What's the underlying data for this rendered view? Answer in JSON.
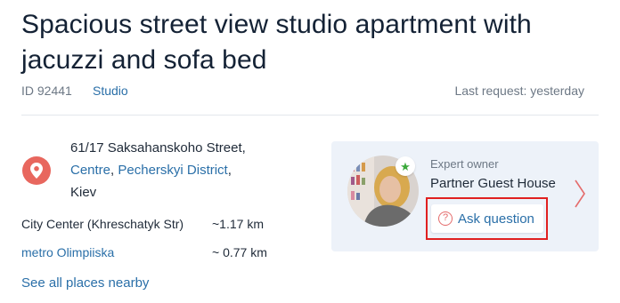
{
  "listing": {
    "title": "Spacious street view studio apartment with jacuzzi and sofa bed",
    "id_text": "ID 92441",
    "type": "Studio",
    "last_request": "Last request: yesterday"
  },
  "address": {
    "street": "61/17 Saksahanskoho Street,",
    "area_link": "Centre",
    "separator": ", ",
    "district_link": "Pecherskyi District",
    "district_suffix": ",",
    "city": "Kiev"
  },
  "distances": [
    {
      "label": "City Center (Khreschatyk Str)",
      "value": "~1.17 km"
    },
    {
      "label": "metro Olimpiiska",
      "value": "~ 0.77 km"
    }
  ],
  "see_all": "See all places nearby",
  "owner": {
    "label": "Expert owner",
    "name": "Partner Guest House",
    "ask_button": "Ask question"
  },
  "colors": {
    "link": "#2a6fa8",
    "card_bg": "#edf2f9",
    "pin": "#e8675e",
    "highlight": "#e02020",
    "badge_star": "#3aa93a"
  },
  "icons": [
    "location-pin-icon",
    "star-icon",
    "question-circle-icon",
    "chevron-right-icon"
  ]
}
